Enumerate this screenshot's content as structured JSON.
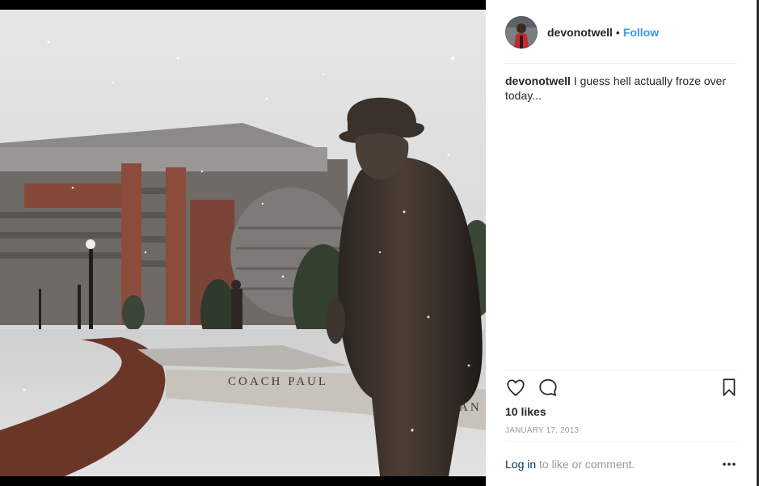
{
  "post": {
    "author": "devonotwell",
    "follow_separator": "•",
    "follow_label": "Follow",
    "caption_user": "devonotwell",
    "caption_text": "I guess hell actually froze over today...",
    "likes": "10 likes",
    "date": "JANUARY 17, 2013"
  },
  "photo": {
    "engraving_text": "COACH PAUL",
    "engraving_text_right": "AN"
  },
  "footer": {
    "login_link": "Log in",
    "login_rest": " to like or comment."
  },
  "icons": {
    "like": "heart-icon",
    "comment": "comment-icon",
    "save": "bookmark-icon",
    "more": "more-options-icon"
  },
  "colors": {
    "follow": "#3897f0",
    "text": "#262626",
    "muted": "#999999",
    "login_link": "#003569"
  }
}
